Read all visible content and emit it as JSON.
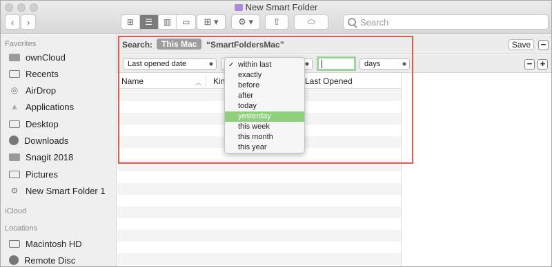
{
  "window": {
    "title": "New Smart Folder"
  },
  "toolbar": {
    "view_buttons": [
      "icon-view-icon",
      "list-view-icon",
      "column-view-icon",
      "gallery-view-icon"
    ],
    "search_placeholder": "Search"
  },
  "sidebar": {
    "favorites_header": "Favorites",
    "favorites": [
      {
        "label": "ownCloud",
        "icon": "folder-icon"
      },
      {
        "label": "Recents",
        "icon": "clock-icon"
      },
      {
        "label": "AirDrop",
        "icon": "airdrop-icon"
      },
      {
        "label": "Applications",
        "icon": "applications-icon"
      },
      {
        "label": "Desktop",
        "icon": "desktop-icon"
      },
      {
        "label": "Downloads",
        "icon": "downloads-icon"
      },
      {
        "label": "Snagit 2018",
        "icon": "folder-icon"
      },
      {
        "label": "Pictures",
        "icon": "pictures-icon"
      },
      {
        "label": "New Smart Folder 1",
        "icon": "gear-icon"
      }
    ],
    "icloud_header": "iCloud",
    "locations_header": "Locations",
    "locations": [
      {
        "label": "Macintosh HD",
        "icon": "hard-drive-icon"
      },
      {
        "label": "Remote Disc",
        "icon": "disc-icon"
      }
    ]
  },
  "search_bar": {
    "label": "Search:",
    "scope_active": "This Mac",
    "scope_folder": "“SmartFoldersMac”",
    "save_label": "Save",
    "minus_label": "−",
    "plus_label": "+"
  },
  "criteria": {
    "attribute": "Last opened date",
    "operator_partial": "i",
    "number_value": "",
    "unit": "days"
  },
  "list": {
    "columns": [
      "Name",
      "Kin",
      "Last Opened"
    ]
  },
  "menu": {
    "items": [
      "within last",
      "exactly",
      "before",
      "after",
      "today",
      "yesterday",
      "this week",
      "this month",
      "this year"
    ],
    "checked_index": 0,
    "highlighted_index": 5
  },
  "colors": {
    "highlight_green": "#8fd07c",
    "annotation_red": "#e05a4f",
    "scope_gray": "#9e9e9e"
  }
}
